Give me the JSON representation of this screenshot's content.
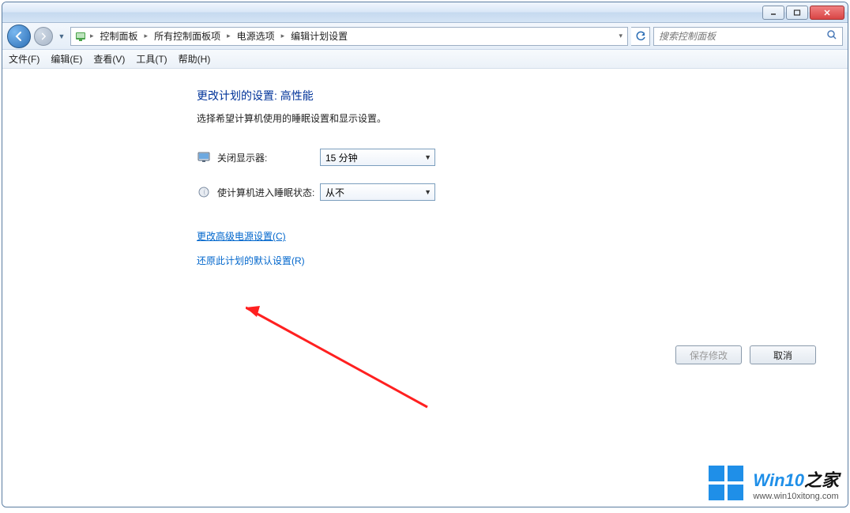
{
  "breadcrumbs": {
    "items": [
      "控制面板",
      "所有控制面板项",
      "电源选项",
      "编辑计划设置"
    ]
  },
  "search": {
    "placeholder": "搜索控制面板"
  },
  "menu": {
    "file": "文件(F)",
    "edit": "编辑(E)",
    "view": "查看(V)",
    "tools": "工具(T)",
    "help": "帮助(H)"
  },
  "page": {
    "heading": "更改计划的设置: 高性能",
    "subtext": "选择希望计算机使用的睡眠设置和显示设置。",
    "display_off_label": "关闭显示器:",
    "display_off_value": "15 分钟",
    "sleep_label": "使计算机进入睡眠状态:",
    "sleep_value": "从不",
    "link_advanced": "更改高级电源设置(C)",
    "link_restore": "还原此计划的默认设置(R)",
    "btn_save": "保存修改",
    "btn_cancel": "取消"
  },
  "watermark": {
    "brand_a": "Win10",
    "brand_b": "之家",
    "url": "www.win10xitong.com"
  }
}
